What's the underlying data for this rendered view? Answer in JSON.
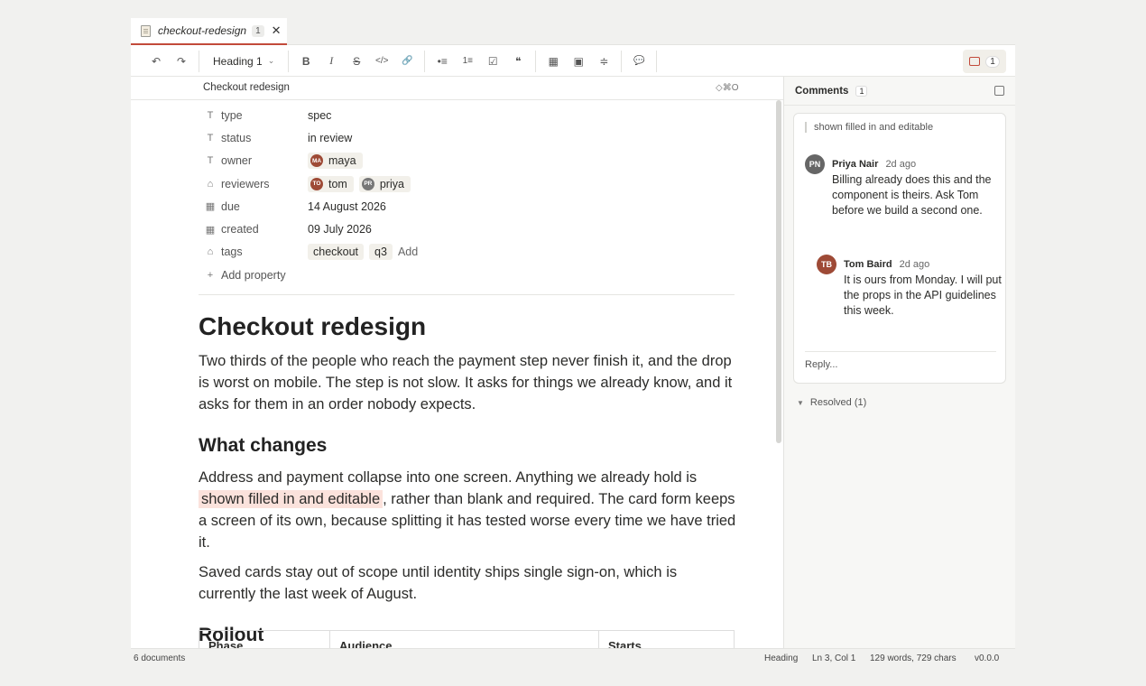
{
  "tab": {
    "title": "checkout-redesign",
    "badge": "1",
    "close": "✕"
  },
  "toolbar": {
    "undo": "↶",
    "redo": "↷",
    "heading_label": "Heading 1",
    "heading_chevron": "⌄",
    "bold": "B",
    "italic": "I",
    "strike": "S",
    "code": "</>",
    "link": "🔗",
    "bullet": "•≡",
    "numbered": "1≡",
    "checklist": "☑",
    "quote": "❝",
    "table": "▦",
    "image": "▣",
    "divider": "≑",
    "comment": "💬",
    "comments_count": "1"
  },
  "editor": {
    "breadcrumb": "Checkout redesign",
    "shortcut": "◇⌘O",
    "properties": [
      {
        "icon": "T",
        "key": "type",
        "value": "spec"
      },
      {
        "icon": "T",
        "key": "status",
        "value": "in review"
      },
      {
        "icon": "T",
        "key": "owner",
        "people": [
          {
            "initials": "MA",
            "name": "maya"
          }
        ]
      },
      {
        "icon": "⌂",
        "key": "reviewers",
        "people": [
          {
            "initials": "TO",
            "name": "tom"
          },
          {
            "initials": "PR",
            "name": "priya"
          }
        ]
      },
      {
        "icon": "▦",
        "key": "due",
        "value": "14 August 2026"
      },
      {
        "icon": "▦",
        "key": "created",
        "value": "09 July 2026"
      },
      {
        "icon": "⌂",
        "key": "tags",
        "tags": [
          "checkout",
          "q3"
        ],
        "add": "Add"
      }
    ],
    "add_property": "Add property",
    "add_property_icon": "+"
  },
  "doc": {
    "title": "Checkout redesign",
    "intro": "Two thirds of the people who reach the payment step never finish it, and the drop is worst on mobile. The step is not slow. It asks for things we already know, and it asks for them in an order nobody expects.",
    "h_changes": "What changes",
    "p1_before": "Address and payment collapse into one screen. Anything we already hold is ",
    "p1_highlight": "shown filled in and editable",
    "p1_after": ", rather than blank and required. The card form keeps a screen of its own, because splitting it has tested worse every time we have tried it.",
    "p2": "Saved cards stay out of scope until identity ships single sign-on, which is currently the last week of August.",
    "h_rollout": "Rollout",
    "table_headers": [
      "Phase",
      "Audience",
      "Starts"
    ]
  },
  "comments": {
    "title": "Comments",
    "count": "1",
    "quote": "shown filled in and editable",
    "items": [
      {
        "initials": "PN",
        "author": "Priya Nair",
        "time": "2d ago",
        "text": "Billing already does this and the component is theirs. Ask Tom before we build a second one."
      },
      {
        "initials": "TB",
        "author": "Tom Baird",
        "time": "2d ago",
        "text": "It is ours from Monday. I will put the props in the API guidelines this week."
      }
    ],
    "reply_placeholder": "Reply...",
    "resolved": "Resolved (1)"
  },
  "statusbar": {
    "documents": "6 documents",
    "block": "Heading",
    "cursor": "Ln 3, Col 1",
    "counts": "129 words, 729 chars",
    "version": "v0.0.0"
  },
  "colors": {
    "accent": "#c24a3a",
    "highlight": "#fbe2dc"
  }
}
